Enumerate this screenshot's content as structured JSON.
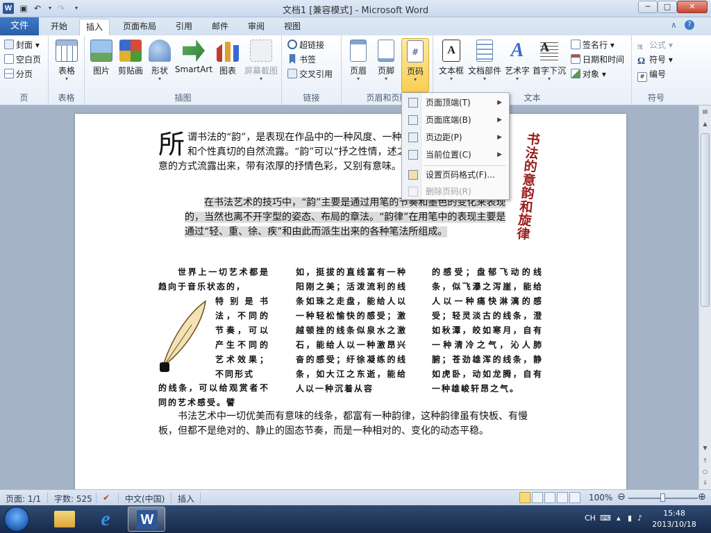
{
  "window": {
    "title": "文档1 [兼容模式] - Microsoft Word",
    "app_icon_letter": "W",
    "min_glyph": "─",
    "max_glyph": "□",
    "close_glyph": "✕"
  },
  "tabs": {
    "file": "文件",
    "items": [
      "开始",
      "插入",
      "页面布局",
      "引用",
      "邮件",
      "审阅",
      "视图"
    ],
    "active": "插入",
    "help_glyph": "?",
    "collapse_glyph": "∧"
  },
  "ribbon": {
    "page_group": {
      "label": "页",
      "items": [
        "封面",
        "空白页",
        "分页"
      ]
    },
    "table_group": {
      "label": "表格",
      "button": "表格"
    },
    "illustrations_group": {
      "label": "插图",
      "buttons": [
        "图片",
        "剪贴画",
        "形状",
        "SmartArt",
        "图表",
        "屏幕截图"
      ]
    },
    "links_group": {
      "label": "链接",
      "items": [
        "超链接",
        "书签",
        "交叉引用"
      ]
    },
    "header_footer_group": {
      "label": "页眉和页脚",
      "buttons": [
        "页眉",
        "页脚",
        "页码"
      ]
    },
    "text_group": {
      "label": "文本",
      "buttons": [
        "文本框",
        "文档部件",
        "艺术字",
        "首字下沉"
      ],
      "items": [
        "签名行",
        "日期和时间",
        "对象"
      ]
    },
    "symbols_group": {
      "label": "符号",
      "items": [
        "公式",
        "符号",
        "编号"
      ]
    }
  },
  "page_number_menu": {
    "items": [
      {
        "label": "页面顶端(T)",
        "submenu": true,
        "enabled": true
      },
      {
        "label": "页面底端(B)",
        "submenu": true,
        "enabled": true
      },
      {
        "label": "页边距(P)",
        "submenu": true,
        "enabled": true
      },
      {
        "label": "当前位置(C)",
        "submenu": true,
        "enabled": true
      },
      {
        "label": "设置页码格式(F)...",
        "submenu": false,
        "enabled": true
      },
      {
        "label": "删除页码(R)",
        "submenu": false,
        "enabled": false
      }
    ]
  },
  "document": {
    "vertical_title": "书法的意韵和旋律",
    "para1_dropcap": "所",
    "para1_text": "谓书法的“韵”，是表现在作品中的一种风度、一种韵致，一个书法家怀古和个性真切的自然流露。“韵”可以“抒之性情，述之自然”，以一种抒情写意的方式流露出来，带有浓厚的抒情色彩，又别有意味。",
    "para2_text": "在书法艺术的技巧中，“韵”主要是通过用笔的节奏和墨色的变化来表现的，当然也离不开字型的姿态、布局的章法。“韵律”在用笔中的表现主要是通过“轻、重、徐、疾”和由此而派生出来的各种笔法所组成。",
    "col1_top": "世界上一切艺术都是趋向于音乐状态的，",
    "col1_side": "特别是书法，不同的节奏，可以产生不同的艺术效果；不同形式",
    "col1_bottom": "的线条，可以给观赏者不同的艺术感受。譬",
    "col2": "如，挺拔的直线富有一种阳刚之美；活泼流利的线条如珠之走盘，能给人以一种轻松愉快的感受；激越顿挫的线条似泉水之激石，能给人以一种激昂兴奋的感受；纡徐凝练的线条，如大江之东逝，能给人以一种沉着从容",
    "col3": "的感受；盘郁飞动的线条，似飞瀑之泻崖，能给人以一种痛快淋漓的感受；轻灵淡古的线条，澄如秋潭，皎如寒月，自有一种清冷之气，沁人肺腑；苍劲雄浑的线条，静如虎卧，动如龙腾，自有一种雄峻轩昂之气。",
    "para3_text": "书法艺术中一切优美而有意味的线条，都富有一种韵律，这种韵律虽有快板、有慢板，但都不是绝对的、静止的固态节奏，而是一种相对的、变化的动态平稳。"
  },
  "status_bar": {
    "page": "页面: 1/1",
    "words": "字数: 525",
    "language": "中文(中国)",
    "mode": "插入",
    "zoom": "100%",
    "zoom_level": 1.0
  },
  "taskbar": {
    "ime": "CH",
    "time": "15:48",
    "date": "2013/10/18"
  },
  "colors": {
    "file_tab": "#2a5ea8",
    "active_button": "#f9cf52",
    "title_red": "#9a1c1c"
  }
}
